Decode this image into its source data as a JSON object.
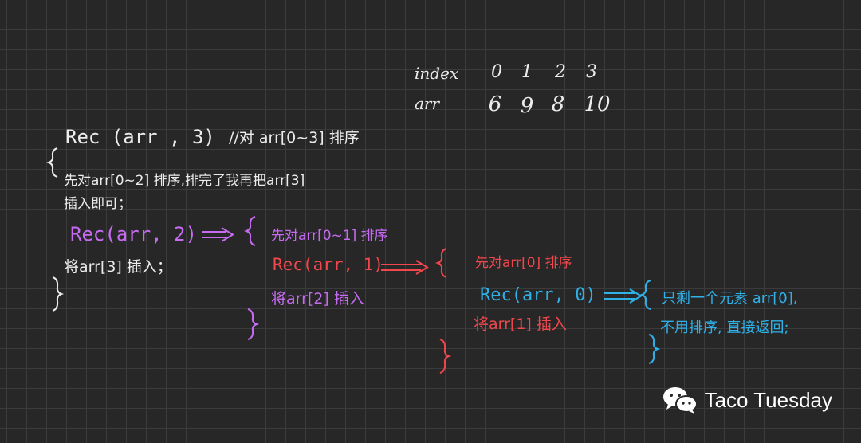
{
  "table": {
    "index_label": "index",
    "arr_label": "arr",
    "indices": [
      "0",
      "1",
      "2",
      "3"
    ],
    "values": [
      "6",
      "9",
      "8",
      "10"
    ]
  },
  "level0": {
    "call": "Rec (arr , 3)",
    "comment": "//对 arr[0~3] 排序",
    "desc_line1": "先对arr[0~2] 排序,排完了我再把arr[3]",
    "desc_line2": "插入即可；",
    "sub_call": "Rec(arr, 2)",
    "insert": "将arr[3] 插入；"
  },
  "level1": {
    "desc": "先对arr[0~1] 排序",
    "sub_call": "Rec(arr, 1)",
    "insert": "将arr[2] 插入"
  },
  "level2": {
    "desc": "先对arr[0] 排序",
    "sub_call": "Rec(arr, 0)",
    "insert": "将arr[1] 插入"
  },
  "level3": {
    "line1": "只剩一个元素 arr[0],",
    "line2": "不用排序, 直接返回;"
  },
  "watermark": {
    "text": "Taco Tuesday",
    "icon": "wechat-icon"
  },
  "colors": {
    "background": "#272727",
    "white": "#ececec",
    "purple": "#c66bf2",
    "red": "#f0474d",
    "cyan": "#2fb1e8"
  }
}
